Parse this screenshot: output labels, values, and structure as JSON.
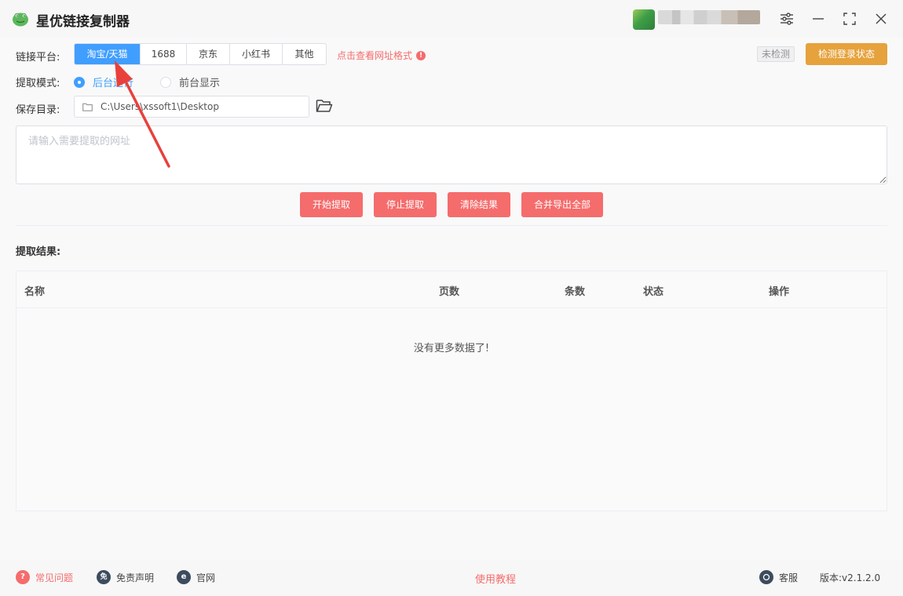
{
  "app": {
    "title": "星优链接复制器"
  },
  "platform": {
    "label": "链接平台:",
    "tabs": [
      {
        "label": "淘宝/天猫",
        "active": true
      },
      {
        "label": "1688",
        "active": false
      },
      {
        "label": "京东",
        "active": false
      },
      {
        "label": "小红书",
        "active": false
      },
      {
        "label": "其他",
        "active": false
      }
    ],
    "format_link": "点击查看网址格式",
    "login_status": "未检测",
    "check_login_button": "检测登录状态"
  },
  "mode": {
    "label": "提取模式:",
    "options": [
      {
        "label": "后台运行",
        "checked": true
      },
      {
        "label": "前台显示",
        "checked": false
      }
    ]
  },
  "save_dir": {
    "label": "保存目录:",
    "path": "C:\\Users\\xssoft1\\Desktop"
  },
  "url_input": {
    "placeholder": "请输入需要提取的网址",
    "value": ""
  },
  "actions": {
    "start": "开始提取",
    "stop": "停止提取",
    "clear": "清除结果",
    "export_all": "合并导出全部"
  },
  "results": {
    "title": "提取结果:",
    "columns": [
      "名称",
      "页数",
      "条数",
      "状态",
      "操作"
    ],
    "rows": [],
    "empty_text": "没有更多数据了!"
  },
  "footer": {
    "faq": "常见问题",
    "disclaimer": "免责声明",
    "disclaimer_glyph": "免",
    "official_site": "官网",
    "tutorial": "使用教程",
    "service": "客服",
    "version": "版本:v2.1.2.0"
  },
  "colors": {
    "primary": "#409eff",
    "danger": "#f56c6c",
    "warning": "#e6a23c",
    "annotation_arrow": "#e8413c"
  }
}
